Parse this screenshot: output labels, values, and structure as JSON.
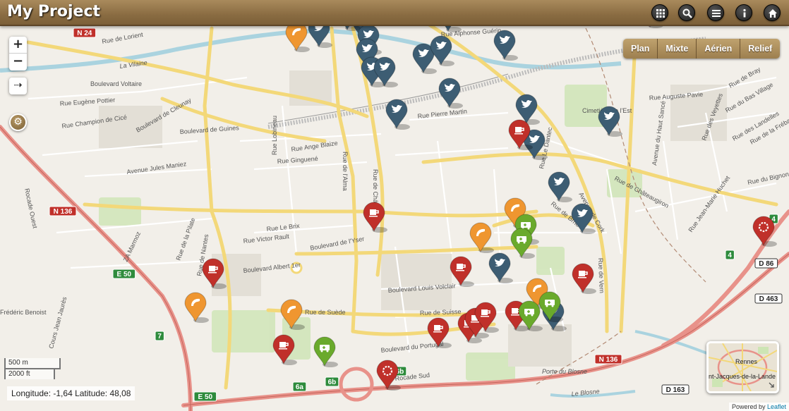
{
  "app": {
    "title": "My Project"
  },
  "header_buttons": [
    {
      "name": "apps-button",
      "icon": "grid-icon"
    },
    {
      "name": "search-button",
      "icon": "search-icon"
    },
    {
      "name": "menu-button",
      "icon": "list-icon"
    },
    {
      "name": "info-button",
      "icon": "info-icon"
    },
    {
      "name": "home-button",
      "icon": "home-icon"
    }
  ],
  "layer_switcher": [
    "Plan",
    "Mixte",
    "Aérien",
    "Relief"
  ],
  "zoom": {
    "in": "+",
    "out": "−"
  },
  "arrow_control": "⇢",
  "scale": {
    "metric": "500 m",
    "imperial": "2000 ft"
  },
  "coordinates": "Longitude: -1,64 Latitude: 48,08",
  "attribution": {
    "prefix": "Powered by ",
    "link": "Leaflet"
  },
  "minimap": {
    "labels": [
      "Rennes",
      "nt-Jacques-de-la-Lande"
    ]
  },
  "road_badges": [
    "N 24",
    "N 136",
    "N 136",
    "E 50",
    "E 50",
    "D 86",
    "D 463",
    "D 163",
    "7",
    "4",
    "4",
    "6a",
    "6b",
    "6b"
  ],
  "streets": [
    "Rue de Lorient",
    "La Vilaine",
    "Boulevard Voltaire",
    "Rue Eugène Pottier",
    "Rue Champion de Cicé",
    "Boulevard de Cleunay",
    "Boulevard de Guines",
    "Rue Ange Blaize",
    "Rue Ginguené",
    "Avenue Jules Maniez",
    "Rue Lobineau",
    "Rue de l'Alma",
    "Rue de Châtillon",
    "Rue Pierre Martin",
    "Rue Alphonse Guérin",
    "Cimetière de l'Est",
    "Rue Auguste Pavie",
    "Rue de Châteaugiron",
    "Rue Le Brix",
    "Rue Victor Rault",
    "Boulevard de l'Yser",
    "Boulevard Albert 1er",
    "Rue de la Pilate",
    "Boulevard Louis Volclair",
    "Rue de Suède",
    "Rue de Suisse",
    "Boulevard du Portugal",
    "Rocade Sud",
    "Porte du Blosne",
    "Le Blosne",
    "Rue de Vern",
    "Rocade Ouest",
    "Rue de Nantes",
    "Cours Jean Jaurès",
    "Frédéric Benoist",
    "ZA Marmoz",
    "Rue de Bray",
    "Rue du Bas Village",
    "Rue des Landelles",
    "Rue de la Frébardière",
    "Rue du Bignon",
    "Avenue du Haut Sancé",
    "Rue des Veyettes",
    "Rue Le Dantec",
    "Avenue de Cork",
    "Rue de Brno",
    "Rue Jean-Marie Huchet"
  ],
  "marker_colors": {
    "twitter": "#3d5d73",
    "coffee": "#c0302a",
    "phone": "#ef9630",
    "ambulance": "#6aaa2c",
    "cutlery": "#c54fb6",
    "spinner": "#c0302a"
  },
  "markers": [
    {
      "type": "phone",
      "icon": "phone-icon"
    },
    {
      "type": "twitter",
      "icon": "twitter-icon"
    },
    {
      "type": "twitter",
      "icon": "twitter-icon"
    },
    {
      "type": "twitter",
      "icon": "twitter-icon"
    },
    {
      "type": "twitter",
      "icon": "twitter-icon"
    },
    {
      "type": "twitter",
      "icon": "twitter-icon"
    },
    {
      "type": "twitter",
      "icon": "twitter-icon"
    },
    {
      "type": "twitter",
      "icon": "twitter-icon"
    },
    {
      "type": "twitter",
      "icon": "twitter-icon"
    },
    {
      "type": "twitter",
      "icon": "twitter-icon"
    },
    {
      "type": "twitter",
      "icon": "twitter-icon"
    },
    {
      "type": "twitter",
      "icon": "twitter-icon"
    },
    {
      "type": "twitter",
      "icon": "twitter-icon"
    },
    {
      "type": "twitter",
      "icon": "twitter-icon"
    },
    {
      "type": "twitter",
      "icon": "twitter-icon"
    },
    {
      "type": "twitter",
      "icon": "twitter-icon"
    },
    {
      "type": "twitter",
      "icon": "twitter-icon"
    },
    {
      "type": "twitter",
      "icon": "twitter-icon"
    },
    {
      "type": "twitter",
      "icon": "twitter-icon"
    },
    {
      "type": "twitter",
      "icon": "twitter-icon"
    },
    {
      "type": "twitter",
      "icon": "twitter-icon"
    },
    {
      "type": "coffee",
      "icon": "coffee-icon"
    },
    {
      "type": "coffee",
      "icon": "coffee-icon"
    },
    {
      "type": "coffee",
      "icon": "coffee-icon"
    },
    {
      "type": "coffee",
      "icon": "coffee-icon"
    },
    {
      "type": "coffee",
      "icon": "coffee-icon"
    },
    {
      "type": "coffee",
      "icon": "coffee-icon"
    },
    {
      "type": "coffee",
      "icon": "coffee-icon"
    },
    {
      "type": "coffee",
      "icon": "coffee-icon"
    },
    {
      "type": "coffee",
      "icon": "coffee-icon"
    },
    {
      "type": "coffee",
      "icon": "coffee-icon"
    },
    {
      "type": "coffee",
      "icon": "coffee-icon"
    },
    {
      "type": "phone",
      "icon": "phone-icon"
    },
    {
      "type": "phone",
      "icon": "phone-icon"
    },
    {
      "type": "phone",
      "icon": "phone-icon"
    },
    {
      "type": "phone",
      "icon": "phone-icon"
    },
    {
      "type": "phone",
      "icon": "phone-icon"
    },
    {
      "type": "ambulance",
      "icon": "ambulance-icon"
    },
    {
      "type": "ambulance",
      "icon": "ambulance-icon"
    },
    {
      "type": "ambulance",
      "icon": "ambulance-icon"
    },
    {
      "type": "ambulance",
      "icon": "ambulance-icon"
    },
    {
      "type": "ambulance",
      "icon": "ambulance-icon"
    },
    {
      "type": "cutlery",
      "icon": "cutlery-icon"
    },
    {
      "type": "spinner",
      "icon": "spinner-icon"
    },
    {
      "type": "spinner",
      "icon": "spinner-icon"
    },
    {
      "type": "spinner",
      "icon": "spinner-icon"
    }
  ]
}
